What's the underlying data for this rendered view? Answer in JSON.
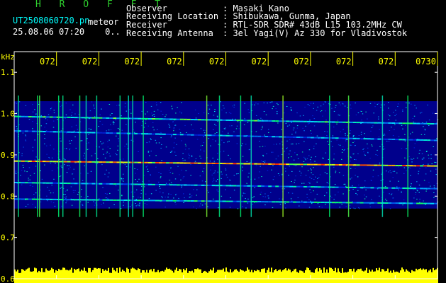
{
  "header": {
    "brand": "H R O F F T",
    "file_name": "UT2508060720.pn",
    "station_label": "meteor",
    "timestamp": "25.08.06 07:20",
    "timestamp_suffix": "0..",
    "fields": [
      {
        "label": "Observer",
        "value": ": Masaki Kano"
      },
      {
        "label": "Receiving Location",
        "value": ": Shibukawa, Gunma, Japan"
      },
      {
        "label": "Receiver",
        "value": ": RTL-SDR SDR# 43dB L15 103.2MHz CW"
      },
      {
        "label": "Receiving Antenna",
        "value": ": 3el Yagi(V) Az 330 for Vladivostok"
      }
    ]
  },
  "colors": {
    "background": "#000000",
    "frame": "#ffffff",
    "time_ticks": "#ffff00",
    "freq_labels": "#ffff00",
    "spectrum_bg": "#00008c",
    "signal_high": "#ff3000",
    "signal_mid": "#00ff80",
    "power_bar": "#ffff00"
  },
  "chart_data": {
    "type": "heatmap",
    "ylabel": "kHz",
    "y_ticks": [
      "1.1",
      "1.0",
      "0.9",
      "0.8",
      "0.7",
      "0.6"
    ],
    "y_tick_values": [
      1.1,
      1.0,
      0.9,
      0.8,
      0.7,
      0.6
    ],
    "ylim": [
      0.6,
      1.15
    ],
    "x_tick_labels": [
      "072",
      "072",
      "072",
      "072",
      "072",
      "072",
      "072",
      "072",
      "072",
      "0730"
    ],
    "x_tick_values": [
      1,
      2,
      3,
      4,
      5,
      6,
      7,
      8,
      9,
      10
    ],
    "xlim": [
      0,
      10
    ],
    "colormap": "blue-cyan-green-yellow-red",
    "signal_region": {
      "x_start": 0,
      "x_end": 10,
      "f_low": 0.77,
      "f_high": 1.03
    },
    "carrier_lines_khz": [
      {
        "f_start": 0.993,
        "f_end": 0.975,
        "intensity": 0.55
      },
      {
        "f_start": 0.958,
        "f_end": 0.935,
        "intensity": 0.4
      },
      {
        "f_start": 0.885,
        "f_end": 0.873,
        "intensity": 0.85
      },
      {
        "f_start": 0.833,
        "f_end": 0.818,
        "intensity": 0.45
      },
      {
        "f_start": 0.793,
        "f_end": 0.782,
        "intensity": 0.5
      }
    ],
    "meteor_streaks_x": [
      0.1,
      0.55,
      0.6,
      1.05,
      1.15,
      1.55,
      1.7,
      1.95,
      2.5,
      2.7,
      2.8,
      3.05,
      4.55,
      4.85,
      5.35,
      5.6,
      6.35,
      7.45,
      7.9,
      8.7,
      9.3
    ],
    "power_profile": "yellow bars along the 0.6 kHz baseline across full time range"
  }
}
